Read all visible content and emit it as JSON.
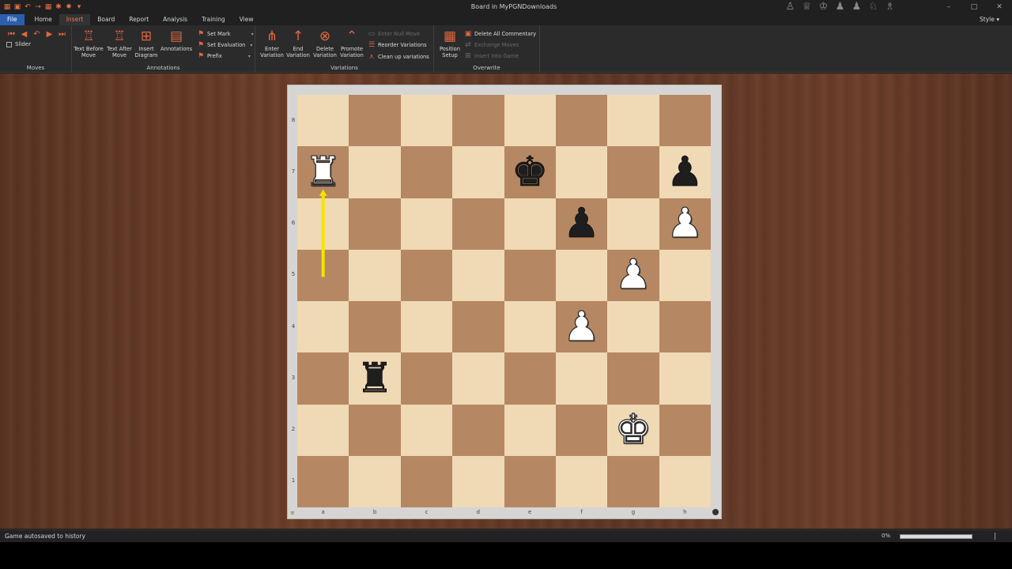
{
  "window": {
    "title": "Board in MyPGNDownloads",
    "controls": [
      "–",
      "□",
      "✕"
    ]
  },
  "tabs": [
    "File",
    "Home",
    "Insert",
    "Board",
    "Report",
    "Analysis",
    "Training",
    "View"
  ],
  "active_tab": "Insert",
  "style_label": "Style",
  "ribbon": {
    "moves": {
      "label": "Moves",
      "slider_label": "Slider"
    },
    "annotations": {
      "label": "Annotations",
      "text_before": [
        "Text Before",
        "Move"
      ],
      "text_after": [
        "Text After",
        "Move"
      ],
      "insert_diagram": [
        "Insert",
        "Diagram"
      ],
      "annotations_btn": "Annotations",
      "set_mark": "Set Mark",
      "set_evaluation": "Set Evaluation",
      "prefix": "Prefix"
    },
    "variations": {
      "label": "Variations",
      "enter": [
        "Enter",
        "Variation"
      ],
      "end": [
        "End",
        "Variation"
      ],
      "delete": [
        "Delete",
        "Variation"
      ],
      "promote": [
        "Promote",
        "Variation"
      ],
      "enter_null_move": "Enter Null Move",
      "reorder": "Reorder Variations",
      "clean_up": "Clean up variations"
    },
    "overwrite": {
      "label": "Overwrite",
      "position_setup": [
        "Position",
        "Setup"
      ],
      "delete_all_commentary": "Delete All Commentary",
      "exchange_moves": "Exchange Moves",
      "insert_into_game": "Insert Into Game"
    }
  },
  "board": {
    "ranks": [
      "8",
      "7",
      "6",
      "5",
      "4",
      "3",
      "2",
      "1"
    ],
    "files": [
      "a",
      "b",
      "c",
      "d",
      "e",
      "f",
      "g",
      "h"
    ],
    "pieces": [
      {
        "square": "a7",
        "piece": "rook",
        "color": "white",
        "glyph": "♜"
      },
      {
        "square": "e7",
        "piece": "king",
        "color": "black",
        "glyph": "♚"
      },
      {
        "square": "h7",
        "piece": "pawn",
        "color": "black",
        "glyph": "♟"
      },
      {
        "square": "f6",
        "piece": "pawn",
        "color": "black",
        "glyph": "♟"
      },
      {
        "square": "h6",
        "piece": "pawn",
        "color": "white",
        "glyph": "♟"
      },
      {
        "square": "g5",
        "piece": "pawn",
        "color": "white",
        "glyph": "♟"
      },
      {
        "square": "f4",
        "piece": "pawn",
        "color": "white",
        "glyph": "♟"
      },
      {
        "square": "b3",
        "piece": "rook",
        "color": "black",
        "glyph": "♜"
      },
      {
        "square": "g2",
        "piece": "king",
        "color": "white",
        "glyph": "♚"
      }
    ],
    "arrow": {
      "from": "a5",
      "to": "a7",
      "color": "#f5e400"
    },
    "light_color": "#f0d9b5",
    "dark_color": "#b58863"
  },
  "status": {
    "message": "Game autosaved to history",
    "zoom": "0%"
  }
}
